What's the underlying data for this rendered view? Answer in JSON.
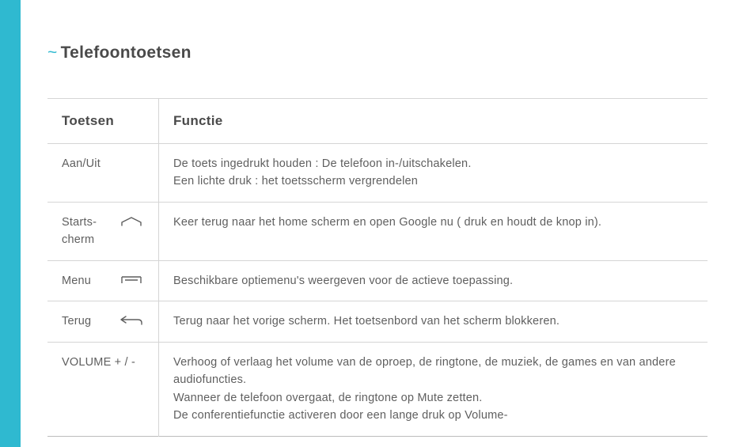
{
  "section_title": "Telefoontoetsen",
  "tilde_mark": "~",
  "headers": {
    "key": "Toetsen",
    "func": "Functie"
  },
  "rows": [
    {
      "label": "Aan/Uit",
      "icon": null,
      "desc": "De toets ingedrukt houden : De telefoon in-/uitschakelen.\nEen lichte druk : het toetsscherm vergrendelen"
    },
    {
      "label": "Starts-cherm",
      "icon": "home",
      "desc": "Keer terug naar het home scherm en open Google nu ( druk en houdt de knop in)."
    },
    {
      "label": "Menu",
      "icon": "menu",
      "desc": "Beschikbare optiemenu's weergeven voor de actieve toepassing."
    },
    {
      "label": "Terug",
      "icon": "back",
      "desc": "Terug naar het vorige scherm. Het toetsenbord van het scherm blokkeren."
    },
    {
      "label": "VOLUME + / -",
      "icon": null,
      "desc": "Verhoog of verlaag het volume van de oproep, de ringtone, de muziek, de games en van andere audiofuncties.\nWanneer de telefoon overgaat, de ringtone op Mute zetten.\nDe conferentiefunctie activeren door een lange druk op Volume-"
    }
  ]
}
